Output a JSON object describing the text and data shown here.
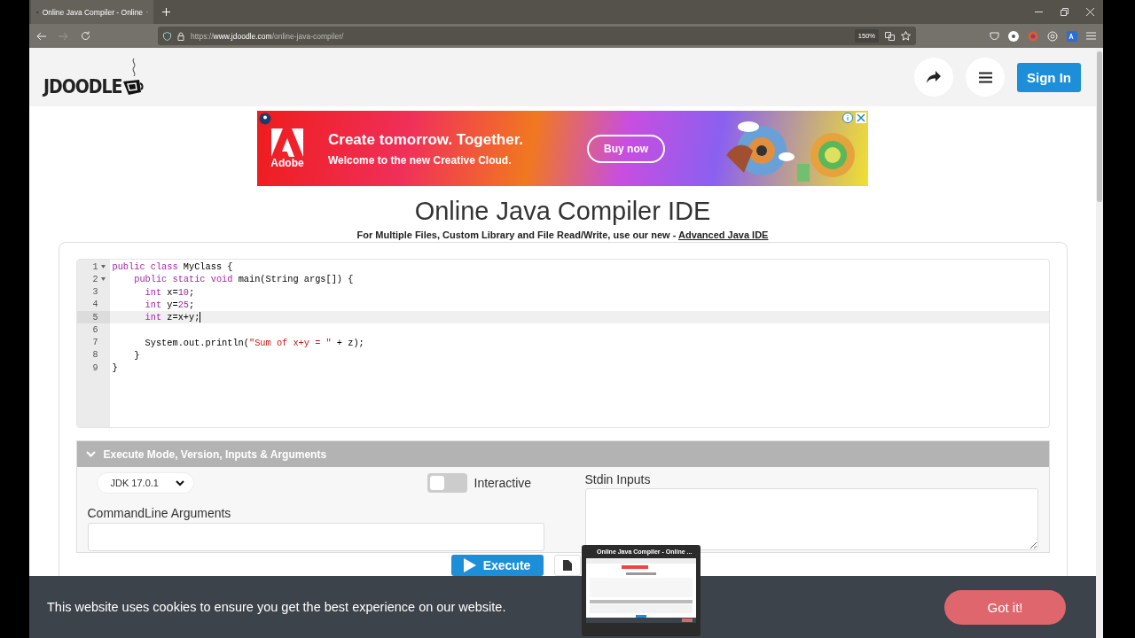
{
  "browser": {
    "tabs": [
      {
        "title": "Online Java Compiler - Online",
        "selected": true
      }
    ],
    "url_host": "www.jdoodle.com",
    "url_prefix": "https://",
    "url_path": "/online-java-compiler/",
    "zoom": "150%",
    "back_disabled": false,
    "forward_disabled": true
  },
  "header": {
    "logo_text": "JDOODLE",
    "sign_in": "Sign In"
  },
  "ad": {
    "brand": "Adobe",
    "headline": "Create tomorrow. Together.",
    "subline": "Welcome to the new Creative Cloud.",
    "cta": "Buy now"
  },
  "title": "Online Java Compiler IDE",
  "subtitle": {
    "text": "For Multiple Files, Custom Library and File Read/Write, use our new - ",
    "link": "Advanced Java IDE"
  },
  "editor": {
    "lines": [
      {
        "number": "1",
        "foldable": true,
        "current": false,
        "segments": [
          {
            "kind": "keyword",
            "text": "public class"
          },
          {
            "kind": "plain",
            "text": " MyClass {"
          }
        ],
        "children": [
          {
            "number": "2",
            "foldable": true,
            "current": false,
            "segments": [
              {
                "kind": "keyword",
                "text": "public static void"
              },
              {
                "kind": "plain",
                "text": " main(String args[]) {"
              }
            ],
            "children": [
              {
                "number": "3",
                "foldable": false,
                "current": false,
                "segments": [
                  {
                    "kind": "keyword",
                    "text": "int"
                  },
                  {
                    "kind": "plain",
                    "text": " x="
                  },
                  {
                    "kind": "number",
                    "text": "10"
                  },
                  {
                    "kind": "plain",
                    "text": ";"
                  }
                ]
              },
              {
                "number": "4",
                "foldable": false,
                "current": false,
                "segments": [
                  {
                    "kind": "keyword",
                    "text": "int"
                  },
                  {
                    "kind": "plain",
                    "text": " y="
                  },
                  {
                    "kind": "number",
                    "text": "25"
                  },
                  {
                    "kind": "plain",
                    "text": ";"
                  }
                ]
              },
              {
                "number": "5",
                "foldable": false,
                "current": true,
                "segments": [
                  {
                    "kind": "keyword",
                    "text": "int"
                  },
                  {
                    "kind": "plain",
                    "text": " z=x+y;"
                  }
                ]
              },
              {
                "number": "6",
                "foldable": false,
                "current": false
              },
              {
                "number": "7",
                "foldable": false,
                "current": false,
                "segments": [
                  {
                    "kind": "plain",
                    "text": "System.out.println("
                  },
                  {
                    "kind": "string",
                    "text": "\"Sum of x+y = \""
                  },
                  {
                    "kind": "plain",
                    "text": " + z);"
                  }
                ]
              }
            ]
          },
          {
            "number": "8",
            "foldable": false,
            "current": false,
            "segments": [
              {
                "kind": "plain",
                "text": "}"
              }
            ]
          }
        ]
      },
      {
        "number": "9",
        "foldable": false,
        "current": false,
        "segments": [
          {
            "kind": "plain",
            "text": "}"
          }
        ]
      }
    ]
  },
  "execute_panel": {
    "title": "Execute Mode, Version, Inputs & Arguments",
    "expanded": true,
    "version": "JDK 17.0.1",
    "interactive": {
      "label": "Interactive",
      "on": false
    },
    "args_label": "CommandLine Arguments",
    "stdin_label": "Stdin Inputs",
    "execute": "Execute"
  },
  "cookie_bar": {
    "text": "This website uses cookies to ensure you get the best experience on our website.",
    "button": "Got it!"
  },
  "tab_preview": {
    "title": "Online Java Compiler - Online ..."
  }
}
